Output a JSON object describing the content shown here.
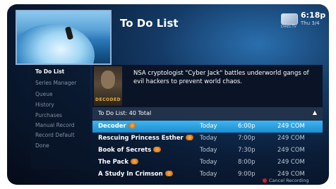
{
  "header": {
    "title": "To Do List",
    "brand": "DIRECTV",
    "time": "6:18p",
    "date": "Thu 3/4"
  },
  "sidebar": {
    "items": [
      {
        "label": "To Do List",
        "active": true
      },
      {
        "label": "Series Manager",
        "active": false
      },
      {
        "label": "Queue",
        "active": false
      },
      {
        "label": "History",
        "active": false
      },
      {
        "label": "Purchases",
        "active": false
      },
      {
        "label": "Manual Record",
        "active": false
      },
      {
        "label": "Record Default",
        "active": false
      },
      {
        "label": "Done",
        "active": false
      }
    ]
  },
  "info": {
    "poster_title": "DECODED",
    "description": "NSA cryptologist \"Cyber Jack\" battles underworld gangs of evil hackers to prevent world chaos."
  },
  "list": {
    "header": "To Do List: 40 Total",
    "rows": [
      {
        "title": "Decoder",
        "day": "Today",
        "time": "6:00p",
        "channel": "249 COM",
        "selected": true
      },
      {
        "title": "Rescuing Princess Esther",
        "day": "Today",
        "time": "7:00p",
        "channel": "249 COM",
        "selected": false
      },
      {
        "title": "Book of Secrets",
        "day": "Today",
        "time": "7:30p",
        "channel": "249 COM",
        "selected": false
      },
      {
        "title": "The Pack",
        "day": "Today",
        "time": "8:00p",
        "channel": "249 COM",
        "selected": false
      },
      {
        "title": "A Study In Crimson",
        "day": "Today",
        "time": "9:00p",
        "channel": "249 COM",
        "selected": false
      }
    ]
  },
  "legend": {
    "label": "Cancel Recording",
    "color": "#d42020"
  },
  "colors": {
    "selected_row": "#2aa0e0",
    "record_icon": "#e8901f"
  }
}
